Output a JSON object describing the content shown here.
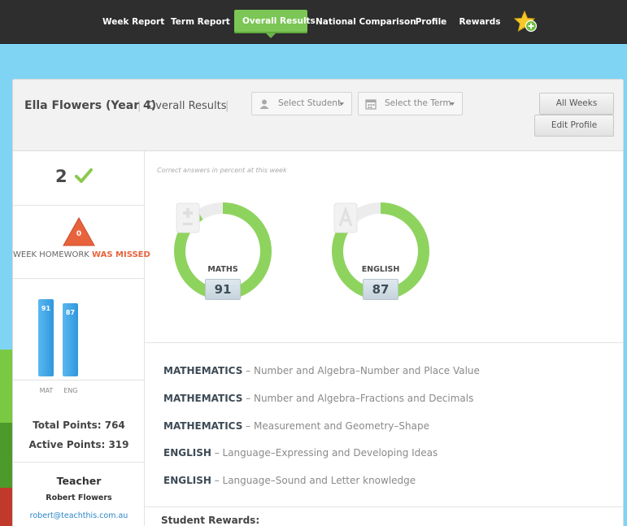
{
  "nav": {
    "items": [
      {
        "label": "Week Report"
      },
      {
        "label": "Term Report"
      },
      {
        "label": "Overall Results",
        "active": true
      },
      {
        "label": "National Comparison"
      },
      {
        "label": "Profile"
      },
      {
        "label": "Rewards"
      }
    ],
    "icon": "star-add-icon"
  },
  "header": {
    "student_name": "Ella Flowers (Year 4)",
    "page_label": "Overall Results",
    "select_student": {
      "label": "Select Student",
      "icon": "user-icon"
    },
    "select_term": {
      "label": "Select the Term",
      "icon": "calendar-icon"
    },
    "all_weeks_label": "All Weeks",
    "edit_profile_label": "Edit Profile"
  },
  "stats": {
    "completed_count": "2",
    "missed_count": "0",
    "missed_text_prefix": "WEEK HOMEWORK ",
    "missed_text_emph": "WAS MISSED",
    "bars": [
      {
        "label": "MAT",
        "value": 91,
        "display": "91"
      },
      {
        "label": "ENG",
        "value": 87,
        "display": "87"
      }
    ],
    "total_points": "Total Points: 764",
    "active_points": "Active Points: 319"
  },
  "teacher": {
    "heading": "Teacher",
    "name": "Robert Flowers",
    "email": "robert@teachthis.com.au"
  },
  "results": {
    "caption": "Correct answers in percent at this week",
    "subjects": [
      {
        "name": "MATHS",
        "score": "91",
        "percent": 91,
        "icon": "calculator-icon"
      },
      {
        "name": "ENGLISH",
        "score": "87",
        "percent": 87,
        "icon": "letter-a-icon"
      }
    ]
  },
  "topics": [
    {
      "subject": "MATHEMATICS",
      "detail": " – Number and Algebra–Number and Place Value"
    },
    {
      "subject": "MATHEMATICS",
      "detail": " – Number and Algebra–Fractions and Decimals"
    },
    {
      "subject": "MATHEMATICS",
      "detail": " – Measurement and Geometry–Shape"
    },
    {
      "subject": "ENGLISH",
      "detail": " – Language–Expressing and Developing Ideas"
    },
    {
      "subject": "ENGLISH",
      "detail": " – Language–Sound and Letter knowledge"
    }
  ],
  "rewards_heading": "Student Rewards:",
  "colors": {
    "nav_bg": "#2e2e2e",
    "active_green": "#7bc655",
    "donut_green": "#8ed35e",
    "bar_blue": "#3aa3e6",
    "missed_red": "#e8633d",
    "sky": "#7fd4f4"
  }
}
